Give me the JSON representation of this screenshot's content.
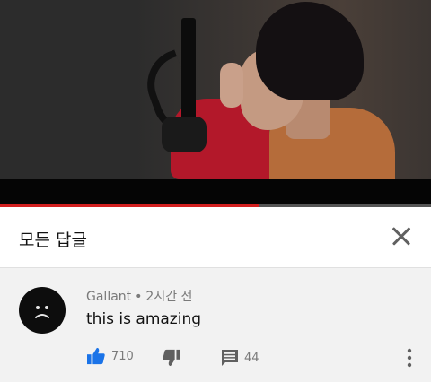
{
  "video": {
    "progress": 0.6
  },
  "sheet": {
    "title": "모든 답글"
  },
  "comment": {
    "author": "Gallant",
    "separator": "•",
    "time": "2시간 전",
    "text": "this is amazing",
    "likes": "710",
    "replies": "44"
  },
  "colors": {
    "like_active": "#1a73e8",
    "progress": "#d21f1f",
    "icon_gray": "#606060"
  },
  "icons": {
    "close": "close-icon",
    "like": "thumbs-up-icon",
    "dislike": "thumbs-down-icon",
    "replies": "comment-icon",
    "more": "more-vertical-icon",
    "avatar": "sad-face-icon"
  }
}
